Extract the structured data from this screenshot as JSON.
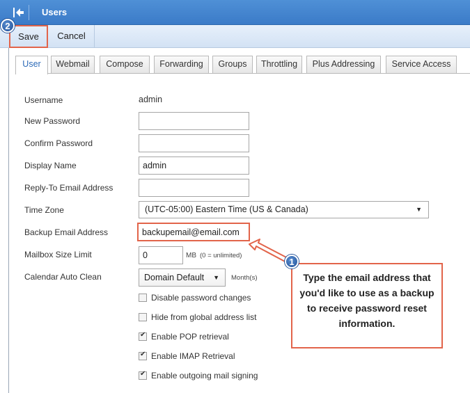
{
  "header": {
    "title": "Users",
    "back_icon": "back-arrow-icon"
  },
  "toolbar": {
    "save_label": "Save",
    "cancel_label": "Cancel"
  },
  "markers": {
    "step1": "1",
    "step2": "2"
  },
  "tabs": [
    "User",
    "Webmail",
    "Compose",
    "Forwarding",
    "Groups",
    "Throttling",
    "Plus Addressing",
    "Service Access"
  ],
  "form": {
    "username_label": "Username",
    "username_value": "admin",
    "new_password_label": "New Password",
    "new_password_value": "",
    "confirm_password_label": "Confirm Password",
    "confirm_password_value": "",
    "display_name_label": "Display Name",
    "display_name_value": "admin",
    "reply_to_label": "Reply-To Email Address",
    "reply_to_value": "",
    "time_zone_label": "Time Zone",
    "time_zone_value": "(UTC-05:00) Eastern Time (US & Canada)",
    "backup_email_label": "Backup Email Address",
    "backup_email_value": "backupemail@email.com",
    "mailbox_limit_label": "Mailbox Size Limit",
    "mailbox_limit_value": "0",
    "mailbox_unit": "MB",
    "mailbox_hint": "(0 = unlimited)",
    "calendar_label": "Calendar Auto Clean",
    "calendar_value": "Domain Default",
    "calendar_unit": "Month(s)"
  },
  "checkboxes": [
    {
      "label": "Disable password changes",
      "checked": false
    },
    {
      "label": "Hide from global address list",
      "checked": false
    },
    {
      "label": "Enable POP retrieval",
      "checked": true
    },
    {
      "label": "Enable IMAP Retrieval",
      "checked": true
    },
    {
      "label": "Enable outgoing mail signing",
      "checked": true
    }
  ],
  "callout": {
    "text": "Type the email address that you'd like to use as a backup to receive password reset information."
  },
  "colors": {
    "accent": "#3b7bc8",
    "highlight": "#e2644a",
    "marker": "#1d4d96"
  }
}
